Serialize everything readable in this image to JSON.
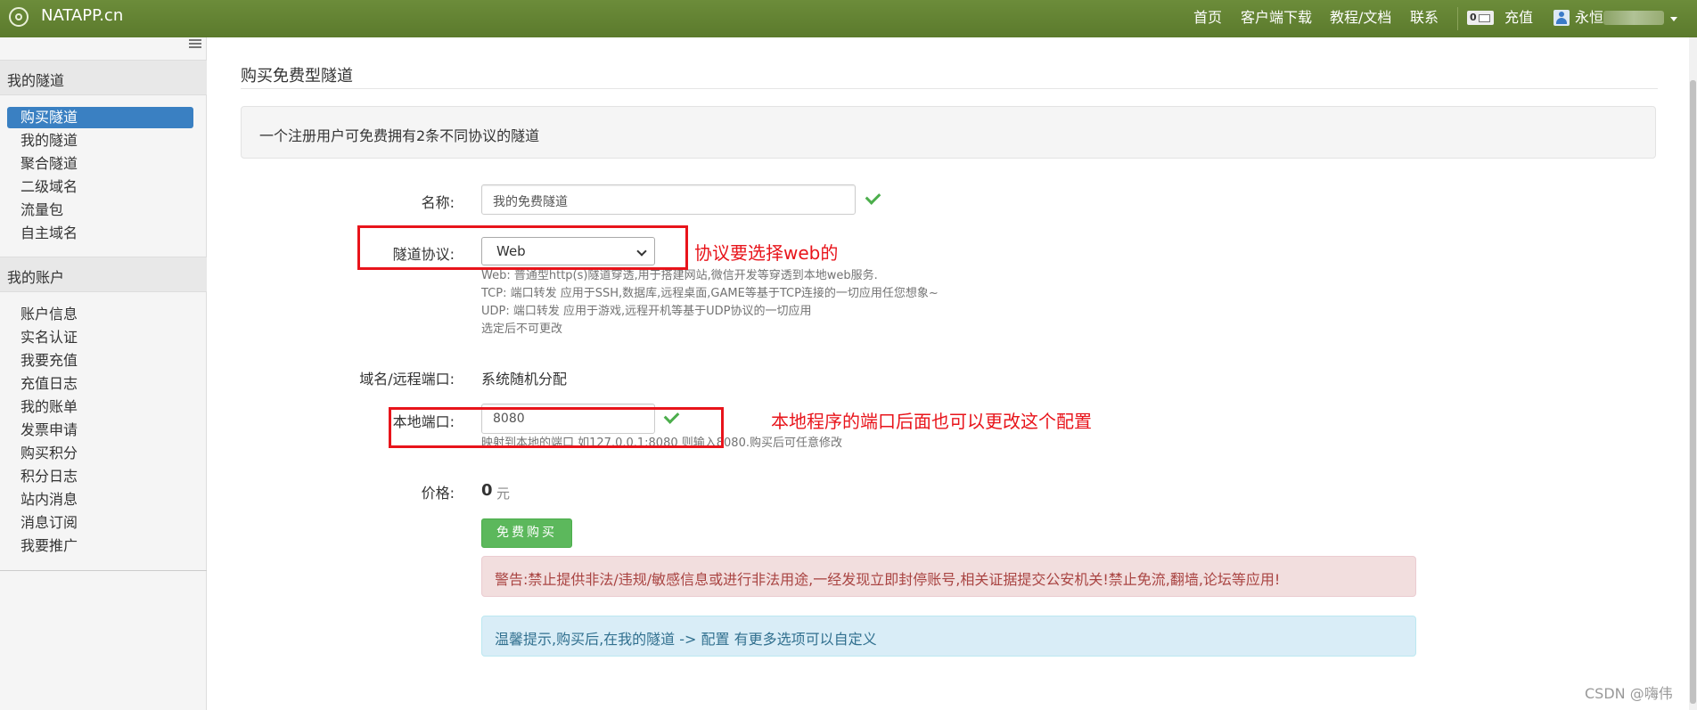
{
  "topbar": {
    "brand": "NATAPP.cn",
    "nav": [
      "首页",
      "客户端下载",
      "教程/文档",
      "联系"
    ],
    "message_count": "0",
    "recharge": "充值",
    "user_name": "永恒"
  },
  "sidebar": {
    "section1_title": "我的隧道",
    "section1_items": [
      "购买隧道",
      "我的隧道",
      "聚合隧道",
      "二级域名",
      "流量包",
      "自主域名"
    ],
    "section2_title": "我的账户",
    "section2_items": [
      "账户信息",
      "实名认证",
      "我要充值",
      "充值日志",
      "我的账单",
      "发票申请",
      "购买积分",
      "积分日志",
      "站内消息",
      "消息订阅",
      "我要推广"
    ]
  },
  "main": {
    "title": "购买免费型隧道",
    "info": "一个注册用户可免费拥有2条不同协议的隧道",
    "name_label": "名称:",
    "name_value": "我的免费隧道",
    "protocol_label": "隧道协议:",
    "protocol_value": "Web",
    "protocol_help": [
      "Web: 普通型http(s)隧道穿透,用于搭建网站,微信开发等穿透到本地web服务.",
      "TCP: 端口转发 应用于SSH,数据库,远程桌面,GAME等基于TCP连接的一切应用任您想象~",
      "UDP: 端口转发 应用于游戏,远程开机等基于UDP协议的一切应用",
      "选定后不可更改"
    ],
    "domain_label": "域名/远程端口:",
    "domain_value": "系统随机分配",
    "port_label": "本地端口:",
    "port_value": "8080",
    "port_help": "映射到本地的端口 如127.0.0.1:8080 则输入8080.购买后可任意修改",
    "price_label": "价格:",
    "price_value": "0",
    "price_unit": "元",
    "buy_button": "免费购买",
    "warning": "警告:禁止提供非法/违规/敏感信息或进行非法用途,一经发现立即封停账号,相关证据提交公安机关!禁止免流,翻墙,论坛等应用!",
    "tip": "温馨提示,购买后,在我的隧道 -> 配置 有更多选项可以自定义"
  },
  "annotations": {
    "protocol_note": "协议要选择web的",
    "port_note": "本地程序的端口后面也可以更改这个配置"
  },
  "watermark": "CSDN @嗨伟",
  "colors": {
    "topbar": "#6c8c3a",
    "sidebar_active": "#3a80c2",
    "button_green": "#5cb85c",
    "annotation_red": "#e8141b"
  }
}
